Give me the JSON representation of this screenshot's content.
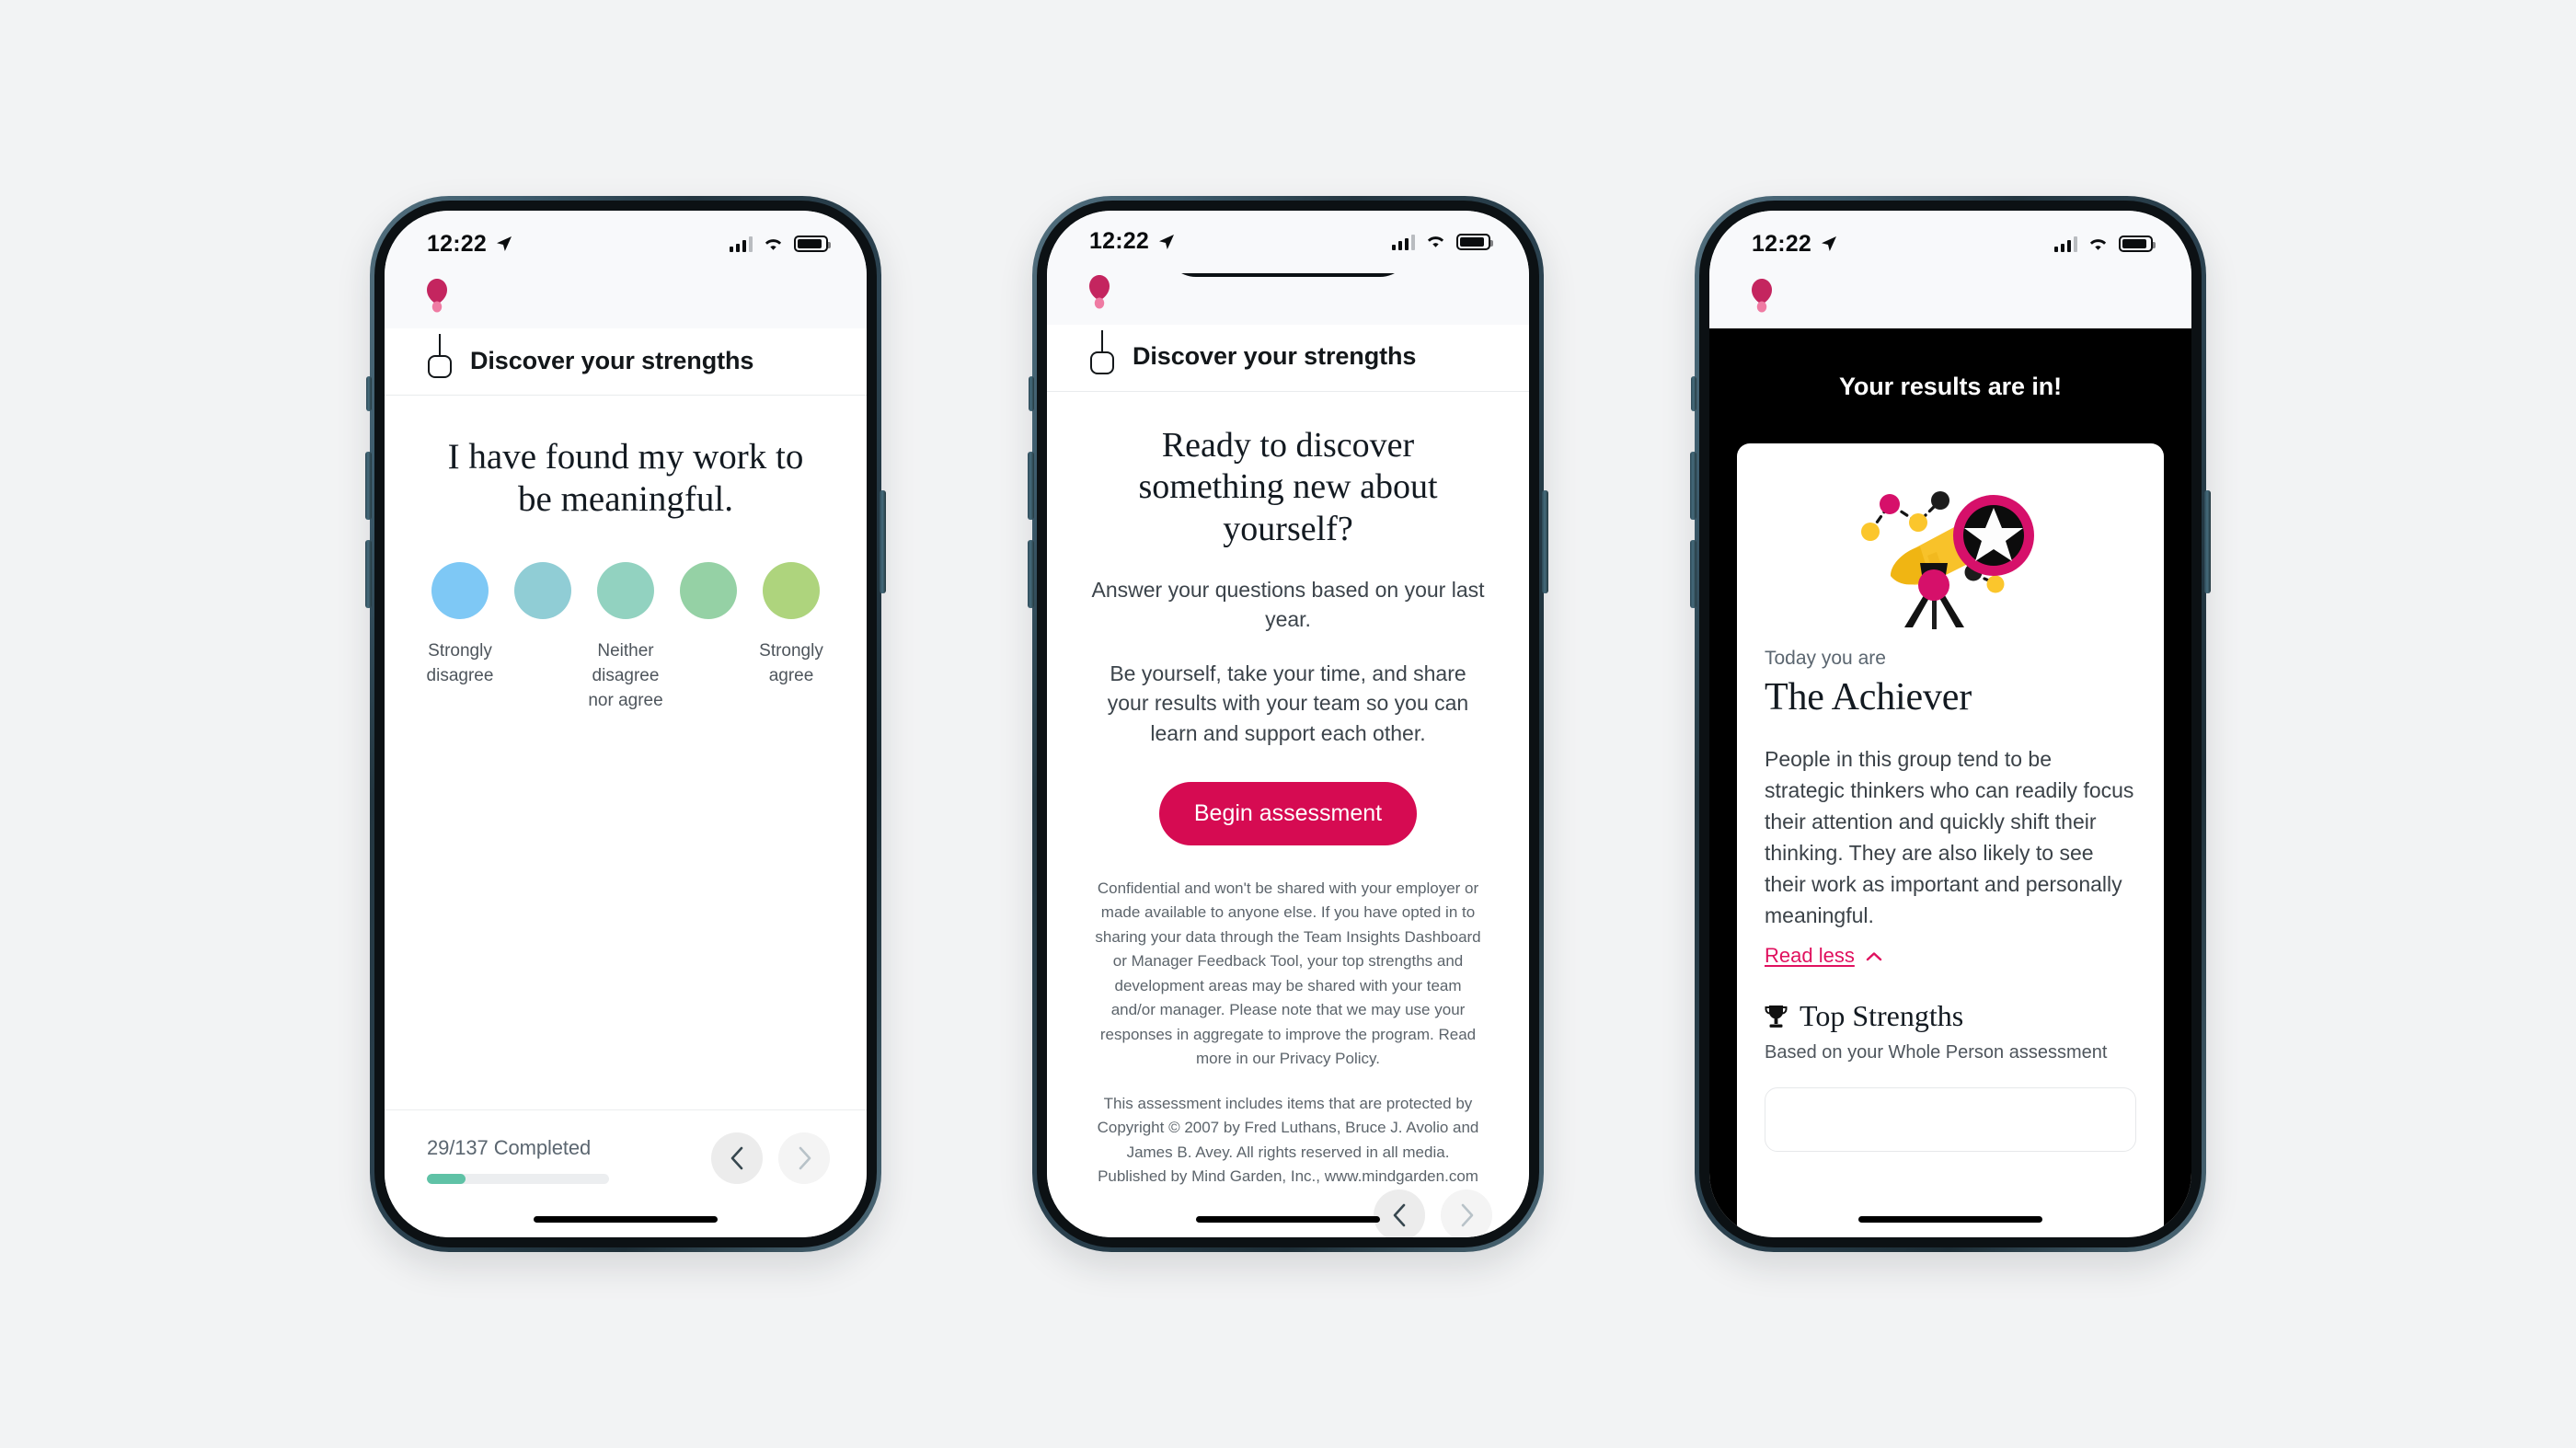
{
  "theme": {
    "page_background": "#f2f3f4",
    "brand_pink": "#d60b52",
    "link_pink": "#e0115f",
    "progress_green": "#5fc2a6",
    "results_background": "#000000"
  },
  "status_bar": {
    "time": "12:22",
    "location_icon": "location-arrow-icon",
    "signal_icon": "cellular-signal-icon",
    "wifi_icon": "wifi-icon",
    "battery_icon": "battery-icon"
  },
  "brand": {
    "logo_icon": "balloon-logo-icon",
    "header_icon": "balloon-outline-icon",
    "app_title": "Discover your strengths"
  },
  "phone_question": {
    "question": "I have found my work to be meaningful.",
    "likert": {
      "options": [
        {
          "label": "Strongly disagree",
          "color": "#7ec8f5"
        },
        {
          "label": "",
          "color": "#90cdd5"
        },
        {
          "label": "Neither disagree nor agree",
          "color": "#92d2c0"
        },
        {
          "label": "",
          "color": "#95d1a5"
        },
        {
          "label": "Strongly agree",
          "color": "#aed47d"
        }
      ]
    },
    "progress": {
      "label": "29/137 Completed",
      "completed": 29,
      "total": 137,
      "percent": 21
    },
    "nav": {
      "back_icon": "chevron-left-icon",
      "forward_icon": "chevron-right-icon",
      "forward_disabled": true
    }
  },
  "phone_intro": {
    "heading": "Ready to discover something new about yourself?",
    "paragraphs": [
      "Answer your questions based on your last year.",
      "Be yourself, take your time, and share your results with your team so you can learn and support each other."
    ],
    "cta_label": "Begin assessment",
    "fineprint": [
      "Confidential and won't be shared with your employer or made available to anyone else. If you have opted in to sharing your data through the Team Insights Dashboard or Manager Feedback Tool, your top strengths and development areas may be shared with your team and/or manager. Please note that we may use your responses in aggregate to improve the program. Read more in our Privacy Policy.",
      "This assessment includes items that are protected by Copyright © 2007 by Fred Luthans, Bruce J. Avolio and James B. Avey. All rights reserved in all media. Published by Mind Garden, Inc., www.mindgarden.com"
    ],
    "nav": {
      "back_icon": "chevron-left-icon",
      "forward_icon": "chevron-right-icon",
      "forward_disabled": true
    }
  },
  "phone_results": {
    "title": "Your results are in!",
    "illustration_icon": "telescope-illustration",
    "today_label": "Today you are",
    "persona": "The Achiever",
    "description": "People in this group tend to be strategic thinkers who can readily focus their attention and quickly shift their thinking. They are also likely to see their work as important and personally meaningful.",
    "read_less_label": "Read less",
    "read_less_icon": "chevron-up-icon",
    "strengths_icon": "trophy-icon",
    "strengths_title": "Top Strengths",
    "strengths_subtitle": "Based on your Whole Person assessment"
  }
}
